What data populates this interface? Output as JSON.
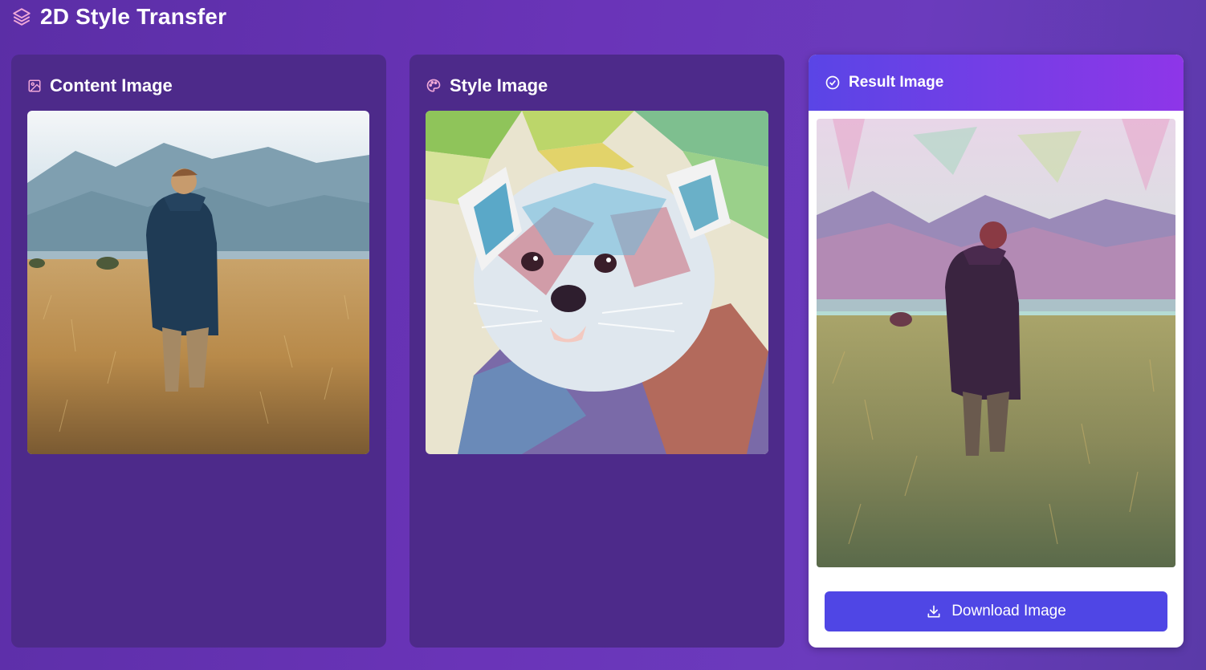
{
  "app": {
    "title": "2D Style Transfer",
    "icon": "layers-icon"
  },
  "panels": {
    "content": {
      "title": "Content Image",
      "icon": "image-icon"
    },
    "style": {
      "title": "Style Image",
      "icon": "palette-icon"
    },
    "result": {
      "title": "Result Image",
      "icon": "check-circle-icon",
      "download_label": "Download Image",
      "download_icon": "download-icon"
    }
  },
  "colors": {
    "accent": "#4f46e5",
    "panel_bg": "#4d2a8a",
    "result_header_start": "#5a45e6",
    "result_header_end": "#8e36e8",
    "icon_pink": "#f0a8d8"
  }
}
